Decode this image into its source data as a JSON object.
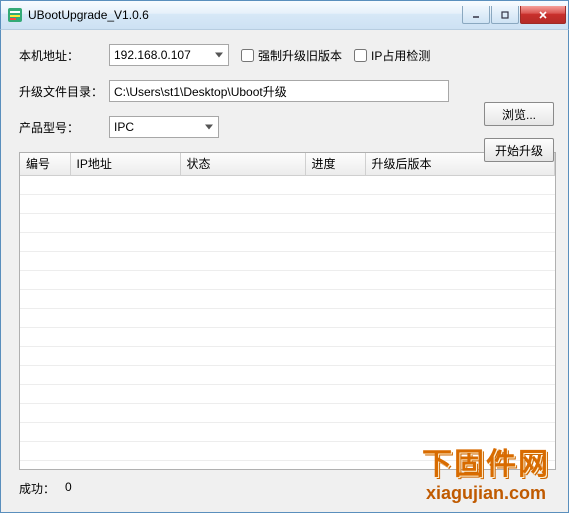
{
  "window": {
    "title": "UBootUpgrade_V1.0.6"
  },
  "labels": {
    "local_ip": "本机地址：",
    "upgrade_dir": "升级文件目录：",
    "product_model": "产品型号：",
    "force_upgrade": "强制升级旧版本",
    "ip_check": "IP占用检测",
    "browse": "浏览...",
    "start": "开始升级",
    "success_prefix": "成功：",
    "success_count": "0"
  },
  "values": {
    "local_ip": "192.168.0.107",
    "upgrade_dir": "C:\\Users\\st1\\Desktop\\Uboot升级",
    "product_model": "IPC",
    "force_upgrade_checked": false,
    "ip_check_checked": false
  },
  "table": {
    "headers": {
      "no": "编号",
      "ip": "IP地址",
      "status": "状态",
      "progress": "进度",
      "version": "升级后版本"
    },
    "rows": []
  },
  "watermark": {
    "cn": "下固件网",
    "url": "xiagujian.com"
  }
}
